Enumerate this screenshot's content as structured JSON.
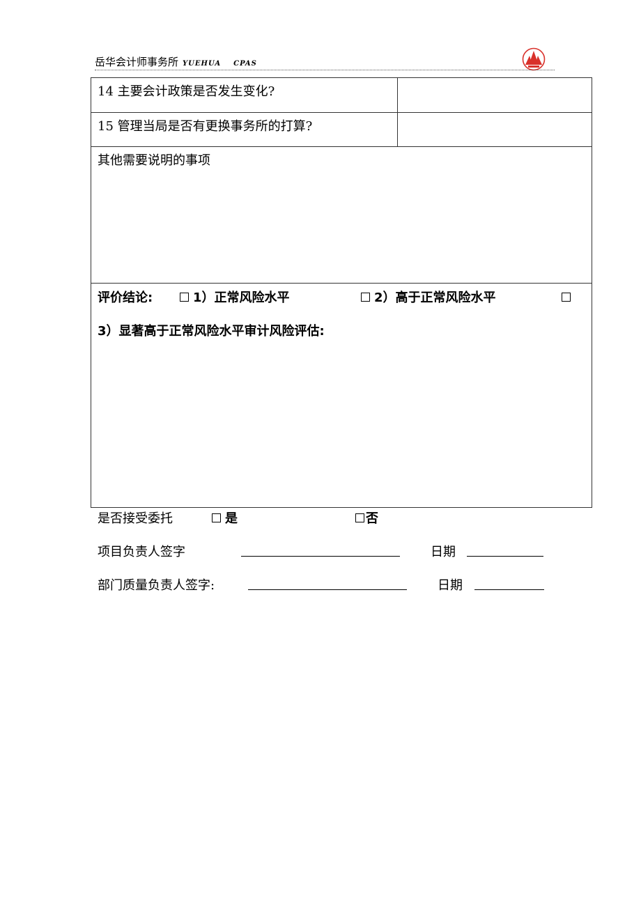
{
  "header": {
    "firm_cn": "岳华会计师事务所",
    "firm_en_1": "YUEHUA",
    "firm_en_2": "CPAS",
    "logo_icon": "yuehua-logo-icon",
    "logo_color": "#d9312b"
  },
  "table": {
    "rows": [
      {
        "question": "14 主要会计政策是否发生变化?",
        "answer": ""
      },
      {
        "question": "15 管理当局是否有更换事务所的打算?",
        "answer": ""
      }
    ],
    "notes_label": "其他需要说明的事项",
    "conclusion": {
      "label": "评价结论:",
      "option1": "1）正常风险水平",
      "option2": "2）高于正常风险水平",
      "option3": "3）显著高于正常风险水平审计风险评估:"
    }
  },
  "accept": {
    "label": "是否接受委托",
    "yes": "是",
    "no": "否"
  },
  "signatures": {
    "project_lead": "项目负责人签字",
    "dept_quality_lead": "部门质量负责人签字:",
    "date_label_1": "日期",
    "date_label_2": "日期"
  }
}
